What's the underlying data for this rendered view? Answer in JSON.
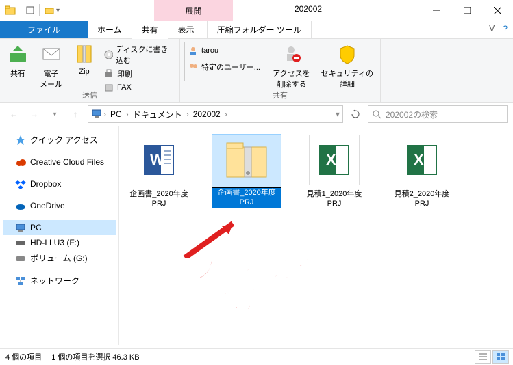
{
  "window": {
    "contextual_tab": "展開",
    "title": "202002"
  },
  "menutabs": {
    "file": "ファイル",
    "home": "ホーム",
    "share": "共有",
    "view": "表示",
    "compress": "圧縮フォルダー ツール"
  },
  "ribbon": {
    "share_btn": "共有",
    "email_btn": "電子\nメール",
    "zip_btn": "Zip",
    "burn": "ディスクに書き込む",
    "print": "印刷",
    "fax": "FAX",
    "group_send": "送信",
    "user1": "tarou",
    "user2": "特定のユーザー...",
    "remove_access": "アクセスを\n削除する",
    "security": "セキュリティの\n詳細",
    "group_share": "共有"
  },
  "address": {
    "pc": "PC",
    "docs": "ドキュメント",
    "folder": "202002",
    "search_placeholder": "202002の検索"
  },
  "nav": {
    "quick": "クイック アクセス",
    "ccf": "Creative Cloud Files",
    "dropbox": "Dropbox",
    "onedrive": "OneDrive",
    "pc": "PC",
    "hd": "HD-LLU3 (F:)",
    "vol": "ボリューム (G:)",
    "net": "ネットワーク"
  },
  "files": {
    "f1": "企画書_2020年度PRJ",
    "f2": "企画書_2020年度PRJ",
    "f3": "見積1_2020年度PRJ",
    "f4": "見積2_2020年度PRJ"
  },
  "status": {
    "count": "4 個の項目",
    "sel": "1 個の項目を選択 46.3 KB"
  },
  "annotation": "圧縮ファイルが\n保存された"
}
